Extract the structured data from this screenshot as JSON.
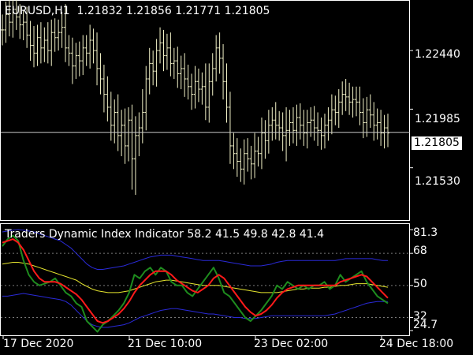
{
  "window": {
    "symbol_timeframe": "EURUSD,H1",
    "ohlc": "1.21832 1.21856 1.21771 1.21805",
    "indicator_title": "Traders Dynamic Index Indicator 58.2 41.5 49.8 42.8 41.4"
  },
  "colors": {
    "background": "#000000",
    "frame": "#ffffff",
    "bars": "#f2f2c8",
    "green_line": "#1e8c1e",
    "red_line": "#ff1a1a",
    "yellow_line": "#e6e62e",
    "blue_band": "#2a2ad8",
    "level_dots": "#7a7a7a"
  },
  "price_axis": {
    "labels": [
      "1.22440",
      "1.21985",
      "1.21530"
    ],
    "current_price": "1.21805",
    "range": [
      1.2113,
      1.2282
    ]
  },
  "indicator_axis": {
    "labels": [
      "81.3",
      "68",
      "50",
      "32",
      "24.7"
    ],
    "levels": [
      68,
      50,
      32
    ],
    "range": [
      22.5,
      84.0
    ]
  },
  "time_axis": {
    "labels": [
      "17 Dec 2020",
      "21 Dec 10:00",
      "23 Dec 02:00",
      "24 Dec 18:00"
    ]
  },
  "chart_data": [
    {
      "type": "ohlc",
      "title": "",
      "series": [
        {
          "name": "EURUSD,H1",
          "close": [
            1.226,
            1.2272,
            1.2266,
            1.2276,
            1.227,
            1.2264,
            1.2266,
            1.2256,
            1.2248,
            1.2242,
            1.2254,
            1.2246,
            1.2252,
            1.2244,
            1.2258,
            1.2254,
            1.2258,
            1.2262,
            1.2246,
            1.2242,
            1.2232,
            1.224,
            1.2236,
            1.2246,
            1.2242,
            1.2252,
            1.2244,
            1.223,
            1.2222,
            1.221,
            1.22,
            1.2186,
            1.2196,
            1.2178,
            1.2186,
            1.217,
            1.219,
            1.216,
            1.2178,
            1.2184,
            1.2196,
            1.2222,
            1.2234,
            1.2228,
            1.2244,
            1.225,
            1.224,
            1.2246,
            1.2234,
            1.2236,
            1.2226,
            1.223,
            1.2222,
            1.2216,
            1.221,
            1.222,
            1.2214,
            1.2216,
            1.22,
            1.222,
            1.223,
            1.2246,
            1.2238,
            1.222,
            1.22,
            1.217,
            1.2164,
            1.2158,
            1.2152,
            1.2164,
            1.216,
            1.2156,
            1.2166,
            1.2164,
            1.218,
            1.2174,
            1.2186,
            1.219,
            1.2186,
            1.2184,
            1.2178,
            1.2182,
            1.2188,
            1.2182,
            1.2192,
            1.2186,
            1.218,
            1.2188,
            1.219,
            1.2184,
            1.2182,
            1.2178,
            1.2186,
            1.219,
            1.2198,
            1.2196,
            1.2204,
            1.221,
            1.2208,
            1.2204,
            1.2206,
            1.2204,
            1.2196,
            1.2188,
            1.2198,
            1.2194,
            1.2186,
            1.2188,
            1.218,
            1.2184,
            1.218
          ],
          "high_offset": [
            0.0012,
            0.001,
            0.0014,
            0.001,
            0.0012,
            0.001,
            0.0009,
            0.0012,
            0.0011,
            0.0015,
            0.001,
            0.0012,
            0.001,
            0.0014,
            0.001,
            0.0011,
            0.001,
            0.0012,
            0.0018,
            0.001,
            0.0012,
            0.001,
            0.0011,
            0.001,
            0.001,
            0.0012,
            0.0009,
            0.0014,
            0.0012,
            0.0011,
            0.0014,
            0.0012,
            0.001,
            0.0014,
            0.0012,
            0.0013,
            0.001,
            0.0012,
            0.0015,
            0.0012,
            0.0018,
            0.001,
            0.0012,
            0.001,
            0.0009,
            0.0012,
            0.001,
            0.0011,
            0.0012,
            0.001,
            0.0011,
            0.001,
            0.0012,
            0.0011,
            0.001,
            0.0012,
            0.001,
            0.0011,
            0.0018,
            0.0014,
            0.0012,
            0.001,
            0.0012,
            0.0011,
            0.0014,
            0.0012,
            0.001,
            0.0012,
            0.001,
            0.0011,
            0.0012,
            0.001,
            0.0014,
            0.0011,
            0.0012,
            0.001,
            0.0012,
            0.001,
            0.0014,
            0.0011,
            0.0012,
            0.0018,
            0.001,
            0.0012,
            0.001,
            0.0011,
            0.0012,
            0.001,
            0.001,
            0.0011,
            0.0012,
            0.001,
            0.0009,
            0.001,
            0.0012,
            0.0011,
            0.001,
            0.001,
            0.0012,
            0.0011,
            0.001,
            0.001,
            0.0012,
            0.0011,
            0.001,
            0.0012,
            0.001,
            0.0011,
            0.001,
            0.001,
            0.0011
          ],
          "low_offset": [
            0.0012,
            0.001,
            0.0011,
            0.0012,
            0.001,
            0.0011,
            0.0012,
            0.001,
            0.0012,
            0.0011,
            0.001,
            0.0012,
            0.0011,
            0.001,
            0.0012,
            0.0011,
            0.001,
            0.0012,
            0.0011,
            0.001,
            0.0014,
            0.001,
            0.0012,
            0.0011,
            0.001,
            0.0012,
            0.001,
            0.0013,
            0.0012,
            0.0014,
            0.0011,
            0.0012,
            0.0014,
            0.0012,
            0.0016,
            0.0014,
            0.0012,
            0.0024,
            0.0028,
            0.0016,
            0.0012,
            0.0014,
            0.0012,
            0.0011,
            0.0012,
            0.001,
            0.0012,
            0.0011,
            0.001,
            0.0012,
            0.0011,
            0.0012,
            0.0014,
            0.001,
            0.0012,
            0.0011,
            0.001,
            0.0012,
            0.001,
            0.0012,
            0.0011,
            0.001,
            0.0012,
            0.0014,
            0.0012,
            0.0014,
            0.0012,
            0.0012,
            0.001,
            0.0012,
            0.001,
            0.0012,
            0.0011,
            0.001,
            0.0012,
            0.0014,
            0.001,
            0.0012,
            0.0011,
            0.001,
            0.0012,
            0.002,
            0.0012,
            0.001,
            0.0012,
            0.0011,
            0.001,
            0.0012,
            0.0011,
            0.001,
            0.0012,
            0.0011,
            0.001,
            0.0012,
            0.0011,
            0.001,
            0.0012,
            0.001,
            0.0011,
            0.001,
            0.0012,
            0.0011,
            0.001,
            0.0012,
            0.0011,
            0.001,
            0.0012,
            0.0011,
            0.001,
            0.0012,
            0.0011
          ]
        }
      ]
    },
    {
      "type": "line",
      "title": "",
      "ylim": [
        22.5,
        84.0
      ],
      "series": [
        {
          "name": "green",
          "values": [
            72,
            76,
            78,
            75,
            64,
            56,
            52,
            50,
            51,
            52,
            54,
            50,
            46,
            44,
            40,
            38,
            30,
            27,
            24,
            28,
            30,
            33,
            36,
            40,
            46,
            56,
            54,
            58,
            60,
            56,
            60,
            58,
            52,
            50,
            50,
            46,
            44,
            48,
            52,
            56,
            60,
            54,
            46,
            44,
            40,
            36,
            32,
            30,
            33,
            36,
            40,
            44,
            50,
            48,
            52,
            50,
            48,
            50,
            48,
            50,
            50,
            52,
            48,
            50,
            56,
            52,
            54,
            56,
            58,
            52,
            48,
            44,
            42,
            40
          ]
        },
        {
          "name": "red",
          "values": [
            74,
            75,
            76,
            74,
            70,
            64,
            58,
            54,
            52,
            52,
            52,
            51,
            49,
            47,
            45,
            42,
            38,
            34,
            30,
            29,
            30,
            32,
            34,
            37,
            41,
            46,
            50,
            53,
            56,
            58,
            58,
            58,
            56,
            53,
            51,
            49,
            47,
            46,
            48,
            50,
            54,
            56,
            54,
            50,
            46,
            42,
            38,
            35,
            33,
            34,
            36,
            39,
            43,
            46,
            48,
            49,
            50,
            50,
            50,
            50,
            50,
            50,
            50,
            50,
            52,
            53,
            54,
            55,
            56,
            55,
            52,
            49,
            46,
            43
          ]
        },
        {
          "name": "yellow",
          "values": [
            62,
            62.5,
            63,
            63,
            62.5,
            62,
            61,
            60,
            59,
            58,
            57,
            56,
            55,
            54,
            53,
            51,
            49.5,
            48,
            47,
            46.5,
            46,
            46,
            46,
            46.5,
            47,
            48,
            49,
            50,
            51,
            52,
            52.5,
            53,
            53,
            52.5,
            52,
            51.5,
            51,
            50.5,
            50,
            50,
            50,
            50,
            49.5,
            49,
            48.5,
            48,
            47.5,
            47,
            46.5,
            46,
            46,
            46,
            46,
            46.5,
            47,
            47.5,
            48,
            48,
            48.5,
            48.5,
            48.5,
            49,
            49,
            49.5,
            50,
            50,
            50.5,
            51,
            51,
            51,
            50.5,
            50,
            49.5,
            49
          ]
        },
        {
          "name": "blue-upper",
          "values": [
            80,
            80.5,
            81,
            81.3,
            81,
            80.5,
            80,
            79,
            78,
            77,
            76,
            75,
            73,
            71,
            68,
            65,
            62,
            60,
            59,
            59,
            59.5,
            60,
            60.5,
            61,
            62,
            63,
            64,
            65,
            66,
            66.5,
            67,
            67,
            67,
            66.5,
            66,
            65.5,
            65,
            64.5,
            64,
            64,
            64,
            64,
            63.5,
            63,
            62.5,
            62,
            61.5,
            61,
            61,
            61,
            61.5,
            62,
            63,
            63.5,
            64,
            64,
            64,
            64,
            64,
            64,
            64,
            64,
            64,
            64,
            64.5,
            65,
            65,
            65,
            65,
            65,
            65,
            64.5,
            64,
            64
          ]
        },
        {
          "name": "blue-lower",
          "values": [
            44,
            44,
            44.5,
            45,
            45.5,
            45,
            44.5,
            44,
            43.5,
            43,
            42.5,
            42,
            41,
            39,
            36,
            33,
            30,
            28,
            27,
            26.5,
            26.5,
            27,
            27.5,
            28,
            29,
            30.5,
            32,
            33,
            34,
            35,
            36,
            36.5,
            37,
            37,
            36.5,
            36,
            35.5,
            35,
            34.5,
            34,
            34,
            33.5,
            33,
            32.5,
            32,
            32,
            31.5,
            31.5,
            31.5,
            32,
            32.5,
            33,
            33,
            33,
            33,
            33,
            33,
            33,
            33,
            33,
            33,
            33,
            33.5,
            34,
            35,
            36,
            37,
            38,
            39,
            40,
            40.5,
            41,
            41,
            41
          ]
        }
      ]
    }
  ]
}
